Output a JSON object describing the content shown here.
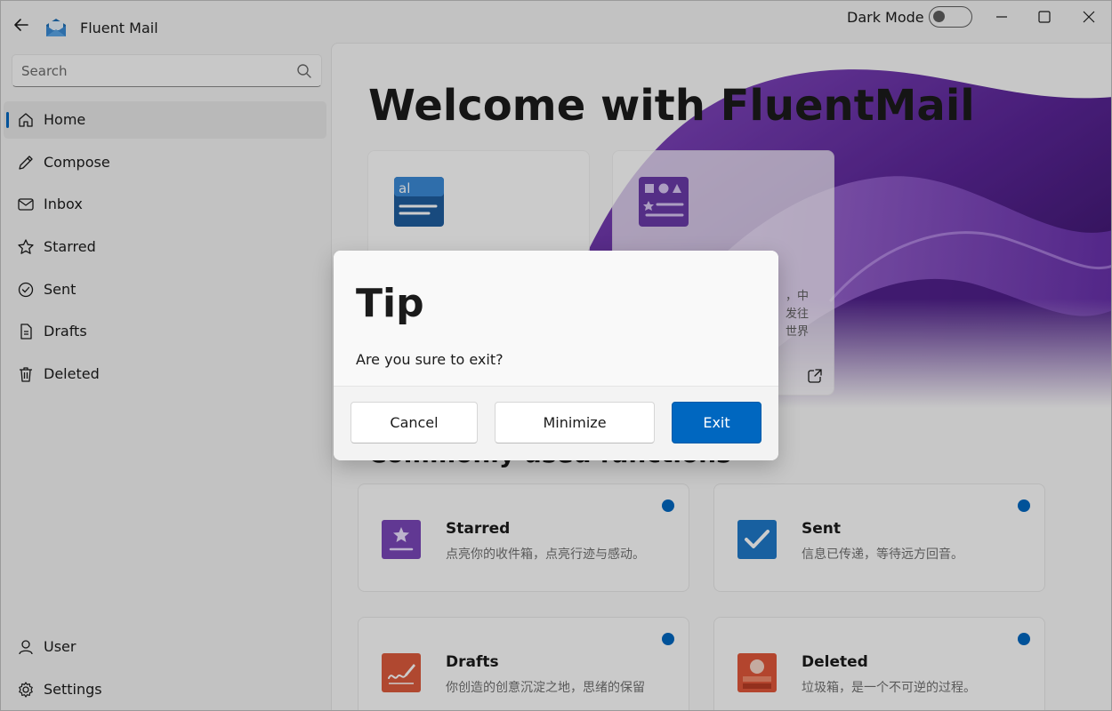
{
  "app": {
    "title": "Fluent Mail",
    "icon": "mail-envelope-icon"
  },
  "titlebar": {
    "dark_mode_label": "Dark Mode",
    "dark_mode_on": false
  },
  "search": {
    "placeholder": "Search",
    "value": ""
  },
  "nav": {
    "items": [
      {
        "label": "Home",
        "icon": "home-icon",
        "active": true
      },
      {
        "label": "Compose",
        "icon": "pencil-icon"
      },
      {
        "label": "Inbox",
        "icon": "mail-icon"
      },
      {
        "label": "Starred",
        "icon": "star-icon"
      },
      {
        "label": "Sent",
        "icon": "checkmark-circle-icon"
      },
      {
        "label": "Drafts",
        "icon": "document-icon"
      },
      {
        "label": "Deleted",
        "icon": "trash-icon"
      }
    ],
    "footer": [
      {
        "label": "User",
        "icon": "person-icon"
      },
      {
        "label": "Settings",
        "icon": "gear-icon"
      }
    ]
  },
  "main": {
    "welcome": "Welcome with FluentMail",
    "link_cards": [
      {
        "icon": "text-blocks-icon",
        "desc": ""
      },
      {
        "icon": "shapes-list-icon",
        "desc": "，中\n发往\n世界"
      }
    ],
    "section_title": "Commonly used functions",
    "functions": [
      {
        "title": "Starred",
        "desc": "点亮你的收件箱，点亮行迹与感动。",
        "icon": "starred-tile-icon"
      },
      {
        "title": "Sent",
        "desc": "信息已传递，等待远方回音。",
        "icon": "sent-tile-icon"
      },
      {
        "title": "Drafts",
        "desc": "你创造的创意沉淀之地，思绪的保留",
        "icon": "drafts-tile-icon"
      },
      {
        "title": "Deleted",
        "desc": "垃圾箱，是一个不可逆的过程。",
        "icon": "deleted-tile-icon"
      }
    ]
  },
  "dialog": {
    "title": "Tip",
    "message": "Are you sure to exit?",
    "cancel_label": "Cancel",
    "minimize_label": "Minimize",
    "exit_label": "Exit"
  },
  "colors": {
    "accent": "#0067c0",
    "purple": "#6b2fa0"
  }
}
